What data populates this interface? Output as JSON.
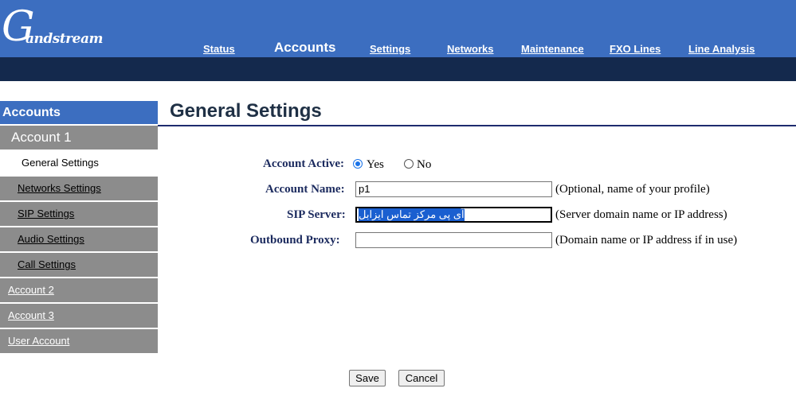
{
  "brand": {
    "logo_initial": "G",
    "logo_text": "andstream"
  },
  "nav": {
    "status": "Status",
    "accounts": "Accounts",
    "settings": "Settings",
    "networks": "Networks",
    "maintenance": "Maintenance",
    "fxo_lines": "FXO Lines",
    "line_analysis": "Line Analysis"
  },
  "sidebar": {
    "header": "Accounts",
    "account1": "Account 1",
    "general_settings": "General Settings",
    "networks_settings": "Networks Settings",
    "sip_settings": "SIP Settings",
    "audio_settings": "Audio Settings",
    "call_settings": "Call Settings",
    "account2": "Account 2",
    "account3": "Account 3",
    "user_account": "User Account"
  },
  "page": {
    "title": "General Settings"
  },
  "form": {
    "account_active": {
      "label": "Account Active:",
      "yes": "Yes",
      "no": "No",
      "selected": "Yes"
    },
    "account_name": {
      "label": "Account Name:",
      "value": "p1",
      "hint": "(Optional, name of your profile)"
    },
    "sip_server": {
      "label": "SIP Server:",
      "value": "آی پی مرکز تماس ایزابل",
      "hint": "(Server domain name or IP address)"
    },
    "outbound_proxy": {
      "label": "Outbound Proxy:",
      "value": "",
      "hint": "(Domain name or IP address if in use)"
    }
  },
  "buttons": {
    "save": "Save",
    "cancel": "Cancel"
  },
  "colors": {
    "header_blue": "#3c6ec0",
    "dark_bar": "#14294d",
    "sidebar_gray": "#8c8c8c",
    "label_navy": "#1b2a5e",
    "selection_blue": "#1a5fd0"
  }
}
